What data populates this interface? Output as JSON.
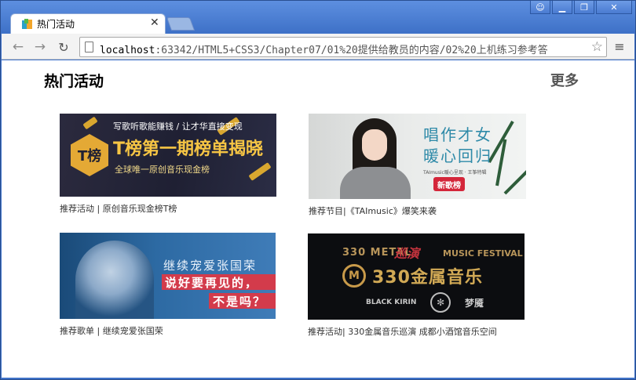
{
  "browser": {
    "tab_title": "热门活动",
    "tab_close": "✕",
    "url_host": "localhost",
    "url_rest": ":63342/HTML5+CSS3/Chapter07/01%20提供给教员的内容/02%20上机练习参考答",
    "window_controls": [
      "user",
      "minimize",
      "restore",
      "close"
    ]
  },
  "page": {
    "heading": "热门活动",
    "more": "更多",
    "cards": [
      {
        "caption": "推荐活动 | 原创音乐现金榜T榜",
        "image": {
          "line1": "写歌听歌能赚钱 / 让才华直接变现",
          "line2": "T榜第一期榜单揭晓",
          "line3": "全球唯一原创音乐现金榜",
          "logo": "T榜"
        }
      },
      {
        "caption": "推荐节目|《TAImusic》爆笑来袭",
        "image": {
          "line1": "唱作才女",
          "line2": "暖心回归",
          "line3": "TAImusic暖心呈现 · 王筝特辑",
          "badge": "新歌榜"
        }
      },
      {
        "caption": "推荐歌单 | 继续宠爱张国荣",
        "image": {
          "line1": "继续宠爱张国荣",
          "line2": "说好要再见的，",
          "line3": "不是吗？"
        }
      },
      {
        "caption": "推荐活动| 330金属音乐巡演 成都小酒馆音乐空间",
        "image": {
          "line1": "330 METAL",
          "line1b": "巡演",
          "line1c": "MUSIC FESTIVAL",
          "ring": "M",
          "line2": "330金属音乐",
          "logos": [
            "BLACK KIRIN",
            "✻",
            "梦魇"
          ]
        }
      }
    ]
  },
  "colors": {
    "chrome_blue": "#3f72c8",
    "heading": "#000000",
    "more": "#555555",
    "caption": "#333333"
  }
}
